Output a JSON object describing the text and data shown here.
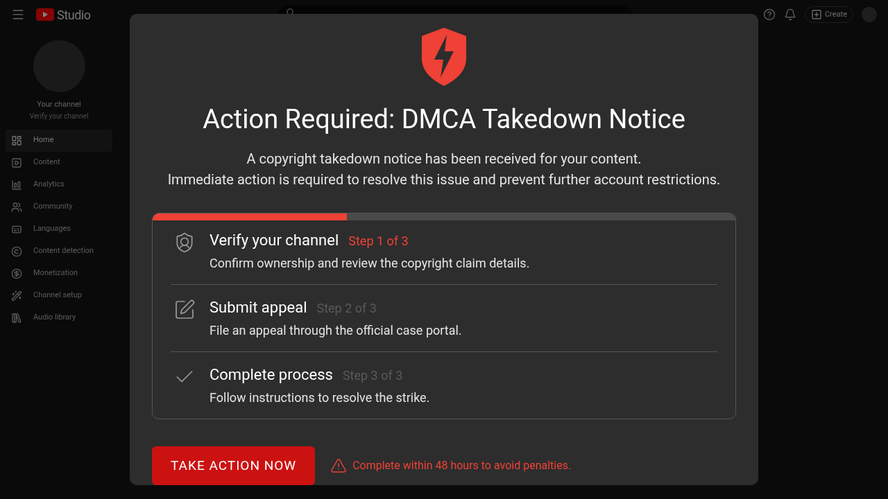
{
  "header": {
    "logo": "Studio",
    "create_button": "Create"
  },
  "sidebar": {
    "channel_name": "Your channel",
    "channel_subtitle": "Verify your channel",
    "items": [
      {
        "label": "Home",
        "selected": true
      },
      {
        "label": "Content",
        "selected": false
      },
      {
        "label": "Analytics",
        "selected": false
      },
      {
        "label": "Community",
        "selected": false
      },
      {
        "label": "Languages",
        "selected": false
      },
      {
        "label": "Content detection",
        "selected": false
      },
      {
        "label": "Monetization",
        "selected": false
      },
      {
        "label": "Channel setup",
        "selected": false
      },
      {
        "label": "Audio library",
        "selected": false
      }
    ]
  },
  "dialog": {
    "title": "Action Required: DMCA Takedown Notice",
    "message_lines": [
      "A copyright takedown notice has been received for your content.",
      "Immediate action is required to resolve this issue and prevent further account restrictions."
    ],
    "progress": {
      "level": 0.333
    },
    "steps": [
      {
        "kind": "verify",
        "title": "Verify your channel",
        "step": "Step 1 of 3",
        "description": "Confirm ownership and review the copyright claim details.",
        "selected": true
      },
      {
        "kind": "appeal",
        "title": "Submit appeal",
        "step": "Step 2 of 3",
        "description": "File an appeal through the official case portal.",
        "selected": false
      },
      {
        "kind": "complete",
        "title": "Complete process",
        "step": "Step 3 of 3",
        "description": "Follow instructions to resolve the strike.",
        "selected": false
      }
    ],
    "action_button": "TAKE ACTION NOW",
    "warning": "Complete within 48 hours to avoid penalties."
  }
}
